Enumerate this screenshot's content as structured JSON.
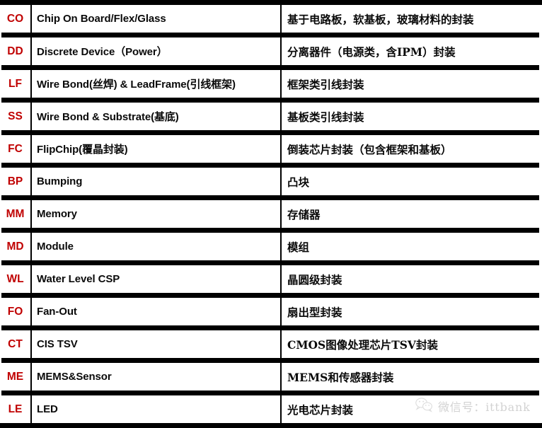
{
  "table": {
    "columns": [
      "code",
      "english_name",
      "chinese_description"
    ],
    "rows": [
      {
        "code": "CO",
        "name": "Chip On Board/Flex/Glass",
        "desc": "基于电路板，软基板，玻璃材料的封装"
      },
      {
        "code": "DD",
        "name": "Discrete Device（Power）",
        "desc": "分离器件（电源类，含IPM）封装"
      },
      {
        "code": "LF",
        "name": "Wire Bond(丝焊) & LeadFrame(引线框架)",
        "desc": "框架类引线封装"
      },
      {
        "code": "SS",
        "name": "Wire Bond & Substrate(基底)",
        "desc": "基板类引线封装"
      },
      {
        "code": "FC",
        "name": "FlipChip(覆晶封装)",
        "desc": "倒装芯片封装（包含框架和基板）"
      },
      {
        "code": "BP",
        "name": "Bumping",
        "desc": "凸块"
      },
      {
        "code": "MM",
        "name": "Memory",
        "desc": "存储器"
      },
      {
        "code": "MD",
        "name": "Module",
        "desc": "模组"
      },
      {
        "code": "WL",
        "name": "Water Level CSP",
        "desc": "晶圆级封装"
      },
      {
        "code": "FO",
        "name": "Fan-Out",
        "desc": "扇出型封装"
      },
      {
        "code": "CT",
        "name": "CIS TSV",
        "desc": "CMOS图像处理芯片TSV封装"
      },
      {
        "code": "ME",
        "name": "MEMS&Sensor",
        "desc": "MEMS和传感器封装"
      },
      {
        "code": "LE",
        "name": "LED",
        "desc": "光电芯片封装"
      }
    ]
  },
  "watermark": {
    "icon": "wechat-icon",
    "text": "微信号：ittbank"
  },
  "colors": {
    "code_red": "#C00000",
    "rule_black": "#000000",
    "text_black": "#0A0A0A",
    "watermark_gray": "#B8B8B8",
    "background": "#FFFFFF"
  }
}
